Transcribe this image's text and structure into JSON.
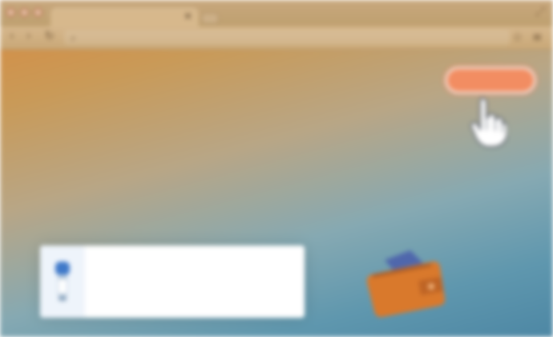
{
  "browser": {
    "window_controls": {
      "close": "close-icon",
      "minimize": "minimize-icon",
      "zoom": "zoom-icon"
    },
    "tab": {
      "close_glyph": "×"
    },
    "toolbar": {
      "back_icon": "‹",
      "forward_icon": "›",
      "reload_icon": "↻",
      "address_search_icon": "⌕",
      "address_text": "",
      "bookmark_icon": "☆",
      "menu_icon": "≡"
    },
    "expand_icon": "⤢"
  },
  "page": {
    "cta_button_label": "",
    "card": {
      "code": "",
      "icon": "usb-key-icon"
    },
    "wallet_icon": "wallet-icon",
    "cursor_icon": "hand-pointer-icon"
  },
  "colors": {
    "gradient_top_left": "#d88a3f",
    "gradient_bottom_right": "#4d87a4",
    "cta": "#f28d62",
    "wallet": "#d9792c",
    "card_bg": "#ffffff"
  }
}
